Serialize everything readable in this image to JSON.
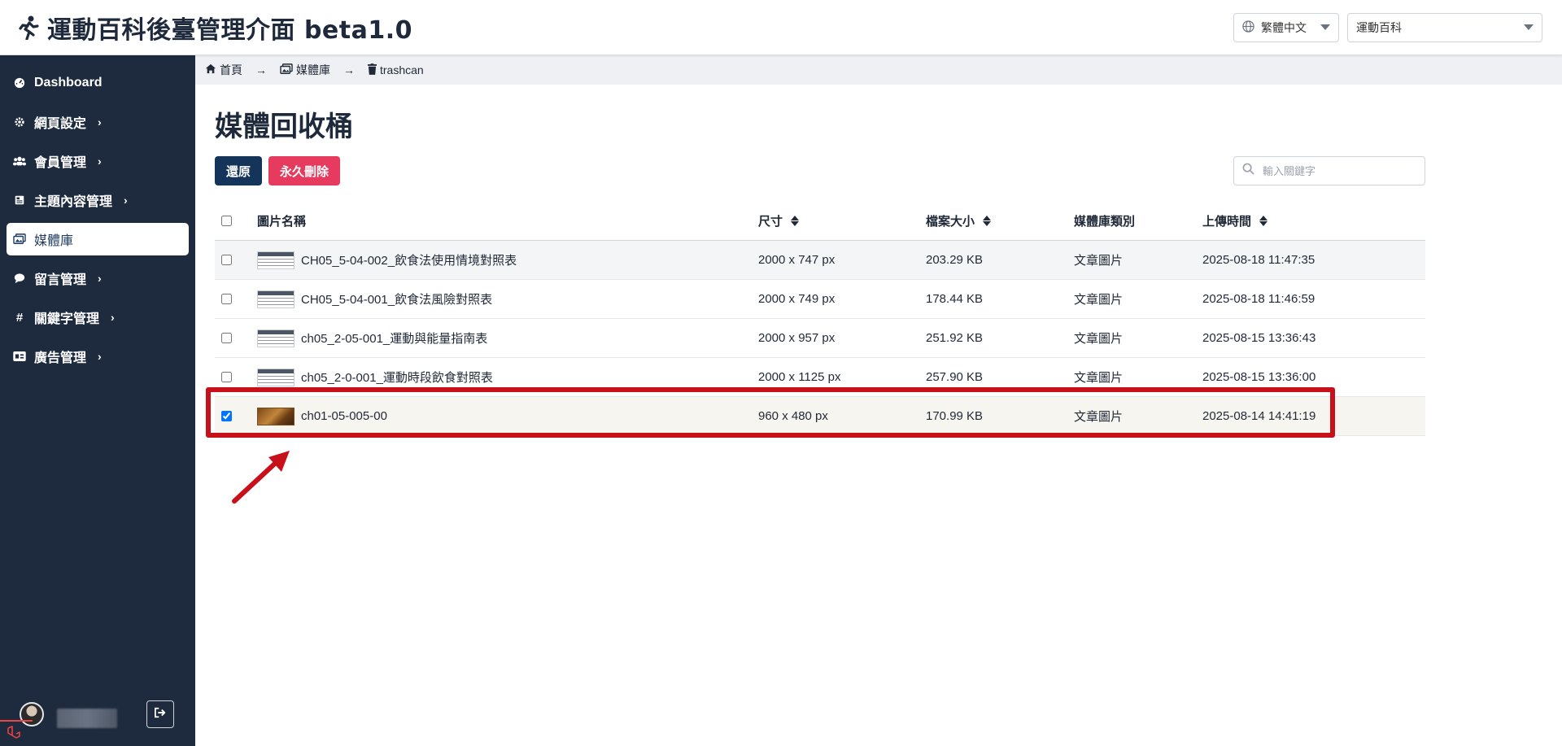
{
  "header": {
    "title": "運動百科後臺管理介面 beta1.0",
    "language": "繁體中文",
    "site": "運動百科"
  },
  "sidebar": {
    "items": [
      {
        "label": "Dashboard",
        "icon": "dashboard-icon"
      },
      {
        "label": "網頁設定",
        "icon": "gear-icon"
      },
      {
        "label": "會員管理",
        "icon": "users-icon"
      },
      {
        "label": "主題內容管理",
        "icon": "newspaper-icon"
      },
      {
        "label": "媒體庫",
        "icon": "images-icon"
      },
      {
        "label": "留言管理",
        "icon": "comment-icon"
      },
      {
        "label": "關鍵字管理",
        "icon": "hashtag-icon"
      },
      {
        "label": "廣告管理",
        "icon": "ad-icon"
      }
    ],
    "active_item": "媒體庫"
  },
  "breadcrumb": {
    "home": "首頁",
    "library": "媒體庫",
    "current": "trashcan"
  },
  "page": {
    "title": "媒體回收桶",
    "restore_label": "還原",
    "delete_label": "永久刪除",
    "search_placeholder": "輸入關鍵字"
  },
  "table": {
    "headers": {
      "name": "圖片名稱",
      "size": "尺寸",
      "filesize": "檔案大小",
      "type": "媒體庫類別",
      "time": "上傳時間"
    },
    "rows": [
      {
        "name": "CH05_5-04-002_飲食法使用情境對照表",
        "size": "2000 x 747 px",
        "filesize": "203.29 KB",
        "type": "文章圖片",
        "time": "2025-08-18 11:47:35",
        "checked": false
      },
      {
        "name": "CH05_5-04-001_飲食法風險對照表",
        "size": "2000 x 749 px",
        "filesize": "178.44 KB",
        "type": "文章圖片",
        "time": "2025-08-18 11:46:59",
        "checked": false
      },
      {
        "name": "ch05_2-05-001_運動與能量指南表",
        "size": "2000 x 957 px",
        "filesize": "251.92 KB",
        "type": "文章圖片",
        "time": "2025-08-15 13:36:43",
        "checked": false
      },
      {
        "name": "ch05_2-0-001_運動時段飲食對照表",
        "size": "2000 x 1125 px",
        "filesize": "257.90 KB",
        "type": "文章圖片",
        "time": "2025-08-15 13:36:00",
        "checked": false
      },
      {
        "name": "ch01-05-005-00",
        "size": "960 x 480 px",
        "filesize": "170.99 KB",
        "type": "文章圖片",
        "time": "2025-08-14 14:41:19",
        "checked": true
      }
    ]
  },
  "colors": {
    "sidebar_bg": "#1e2a3d",
    "restore_button": "#14345a",
    "delete_button": "#e63b5e",
    "annotation_red": "#c8101a"
  }
}
